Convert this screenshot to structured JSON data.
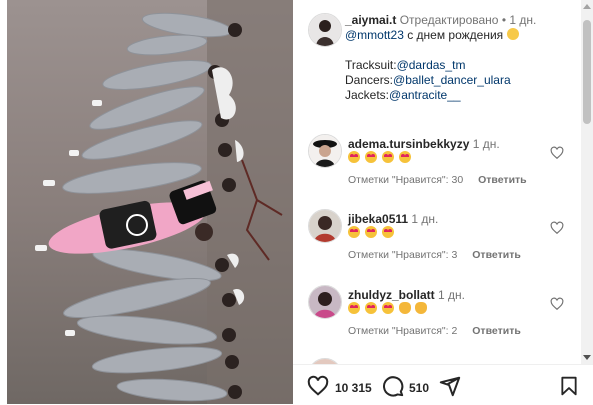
{
  "post": {
    "username": "_aiymai.t",
    "edited_label": "Отредактировано",
    "separator": "•",
    "time": "1 дн.",
    "caption": {
      "mention": "@mmott23",
      "text": " с днем рождения",
      "emoji": "smiling-face-with-halo-emoji",
      "tracksuit_label": "Tracksuit:",
      "tracksuit_link": "@dardas_tm",
      "dancers_label": "Dancers:",
      "dancers_link": "@ballet_dancer_ulara",
      "jackets_label": "Jackets:",
      "jackets_link": "@antracite__"
    }
  },
  "comments": [
    {
      "username": "adema.tursinbekkyzy",
      "time": "1 дн.",
      "emojis": [
        "heart-eyes",
        "heart-eyes",
        "heart-eyes",
        "heart-eyes"
      ],
      "likes_text": "Отметки \"Нравится\": 30",
      "reply_label": "Ответить"
    },
    {
      "username": "jibeka0511",
      "time": "1 дн.",
      "emojis": [
        "heart-eyes",
        "heart-eyes",
        "heart-eyes"
      ],
      "likes_text": "Отметки \"Нравится\": 3",
      "reply_label": "Ответить"
    },
    {
      "username": "zhuldyz_bollatt",
      "time": "1 дн.",
      "emojis": [
        "heart-eyes",
        "heart-eyes",
        "heart-eyes",
        "clap",
        "clap"
      ],
      "likes_text": "Отметки \"Нравится\": 2",
      "reply_label": "Ответить"
    }
  ],
  "actions": {
    "like_count": "10 315",
    "comment_count": "510",
    "like_icon": "heart-icon",
    "comment_icon": "comment-icon",
    "share_icon": "share-icon",
    "save_icon": "bookmark-icon"
  },
  "colors": {
    "link": "#00376b",
    "muted": "#737373",
    "media_bg": "#8b8584",
    "tracksuit_grey": "#a9adb4",
    "pink": "#f1a6c6"
  }
}
